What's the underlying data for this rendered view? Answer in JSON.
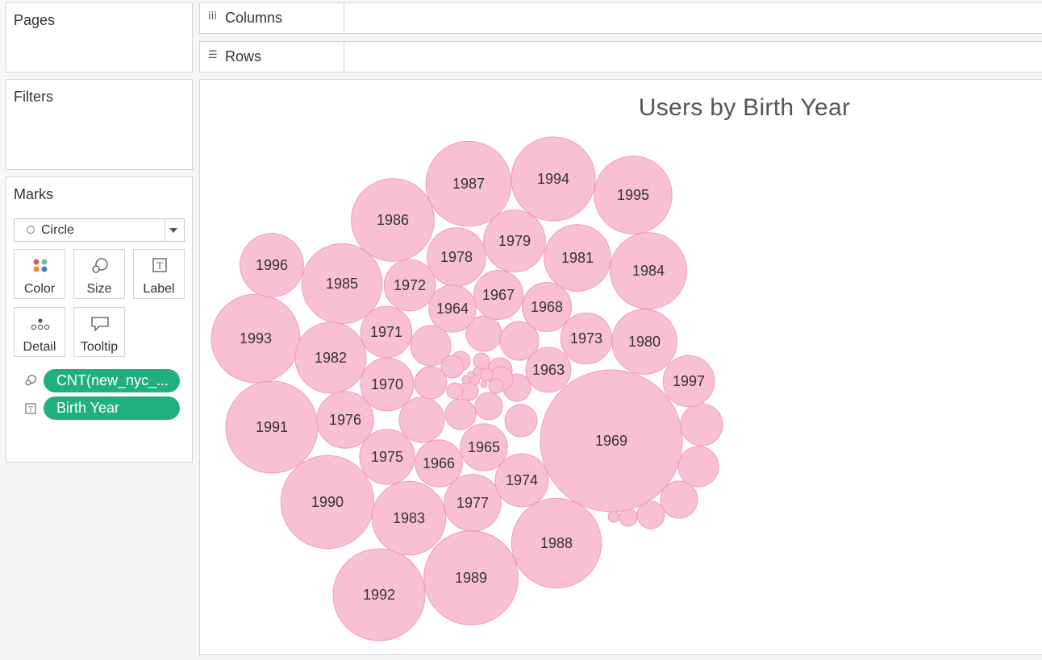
{
  "sidebar": {
    "pages_title": "Pages",
    "filters_title": "Filters",
    "marks": {
      "title": "Marks",
      "mark_type": "Circle",
      "buttons": {
        "color": "Color",
        "size": "Size",
        "label": "Label",
        "detail": "Detail",
        "tooltip": "Tooltip"
      },
      "pills": {
        "size_field": "CNT(new_nyc_...",
        "label_field": "Birth Year"
      }
    }
  },
  "shelves": {
    "columns": "Columns",
    "rows": "Rows"
  },
  "colors": {
    "bubble_fill": "#f9c0d3",
    "bubble_stroke": "#f29bb2",
    "pill": "#1fb07e"
  },
  "chart_data": {
    "type": "packed-bubble",
    "title": "Users by Birth Year",
    "size_measure": "CNT(new_nyc_...",
    "label_dimension": "Birth Year",
    "bubbles": [
      {
        "label": "1969",
        "size": 1.0
      },
      {
        "label": "1993",
        "size": 0.39
      },
      {
        "label": "1991",
        "size": 0.42
      },
      {
        "label": "1990",
        "size": 0.43
      },
      {
        "label": "1992",
        "size": 0.42
      },
      {
        "label": "1989",
        "size": 0.44
      },
      {
        "label": "1988",
        "size": 0.4
      },
      {
        "label": "1987",
        "size": 0.36
      },
      {
        "label": "1994",
        "size": 0.35
      },
      {
        "label": "1986",
        "size": 0.34
      },
      {
        "label": "1985",
        "size": 0.32
      },
      {
        "label": "1995",
        "size": 0.3
      },
      {
        "label": "1984",
        "size": 0.29
      },
      {
        "label": "1983",
        "size": 0.27
      },
      {
        "label": "1982",
        "size": 0.25
      },
      {
        "label": "1981",
        "size": 0.22
      },
      {
        "label": "1980",
        "size": 0.21
      },
      {
        "label": "1996",
        "size": 0.2
      },
      {
        "label": "1979",
        "size": 0.19
      },
      {
        "label": "1977",
        "size": 0.16
      },
      {
        "label": "1976",
        "size": 0.16
      },
      {
        "label": "1975",
        "size": 0.15
      },
      {
        "label": "1978",
        "size": 0.17
      },
      {
        "label": "1997",
        "size": 0.13
      },
      {
        "label": "1974",
        "size": 0.14
      },
      {
        "label": "1973",
        "size": 0.13
      },
      {
        "label": "1972",
        "size": 0.13
      },
      {
        "label": "1971",
        "size": 0.13
      },
      {
        "label": "1970",
        "size": 0.14
      },
      {
        "label": "1968",
        "size": 0.12
      },
      {
        "label": "1967",
        "size": 0.12
      },
      {
        "label": "1966",
        "size": 0.11
      },
      {
        "label": "1965",
        "size": 0.11
      },
      {
        "label": "1964",
        "size": 0.11
      },
      {
        "label": "1963",
        "size": 0.1
      }
    ],
    "unlabeled_bubble_count": 30
  }
}
